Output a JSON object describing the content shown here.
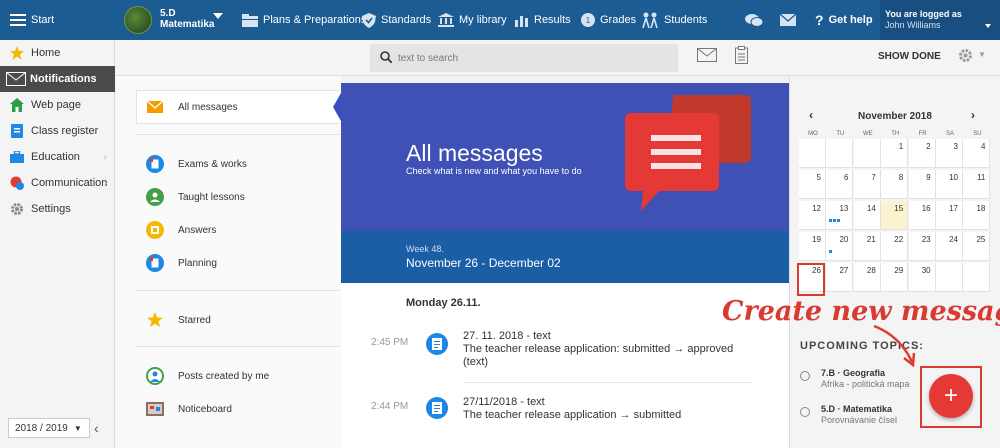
{
  "topbar": {
    "start_label": "Start",
    "class_name": "5.D",
    "subject_name": "Matematika",
    "nav": [
      "Plans & Preparations",
      "Standards",
      "My library",
      "Results",
      "Grades",
      "Students"
    ],
    "help_label": "Get help",
    "logged_label": "You are logged as",
    "user_name": "John Williams"
  },
  "sidebar": {
    "items": [
      "Home",
      "Notifications",
      "Web page",
      "Class register",
      "Education",
      "Communication",
      "Settings"
    ],
    "year": "2018 / 2019"
  },
  "search": {
    "placeholder": "text to search"
  },
  "toolbar": {
    "show_done": "SHOW DONE"
  },
  "filters": {
    "items": [
      "All messages",
      "Exams & works",
      "Taught lessons",
      "Answers",
      "Planning",
      "Starred",
      "Posts created by me",
      "Noticeboard"
    ]
  },
  "banner": {
    "title": "All messages",
    "subtitle": "Check what is new and what you have to do",
    "week_label": "Week 48.",
    "week_dates": "November 26 - December 02"
  },
  "messages": {
    "day": "Monday 26.11.",
    "items": [
      {
        "time": "2:45 PM",
        "title": "27. 11. 2018 - text",
        "body": "The teacher release application: submitted → approved (text)"
      },
      {
        "time": "2:44 PM",
        "title": "27/11/2018 - text",
        "body": "The teacher release application → submitted"
      }
    ]
  },
  "calendar": {
    "month": "November 2018",
    "prev": "‹",
    "next": "›",
    "dow": [
      "MO",
      "TU",
      "WE",
      "TH",
      "FR",
      "SA",
      "SU"
    ],
    "weeks": [
      [
        "",
        "",
        "",
        "1",
        "2",
        "3",
        "4"
      ],
      [
        "5",
        "6",
        "7",
        "8",
        "9",
        "10",
        "11"
      ],
      [
        "12",
        "13",
        "14",
        "15",
        "16",
        "17",
        "18"
      ],
      [
        "19",
        "20",
        "21",
        "22",
        "23",
        "24",
        "25"
      ],
      [
        "26",
        "27",
        "28",
        "29",
        "30",
        "",
        ""
      ]
    ],
    "today": "15"
  },
  "upcoming": {
    "heading": "UPCOMING TOPICS:",
    "items": [
      {
        "title": "7.B · Geografia",
        "subtitle": "Afrika - politická mapa"
      },
      {
        "title": "5.D · Matematika",
        "subtitle": "Porovnávanie čísel"
      }
    ]
  },
  "annotation": "Create new message",
  "fab_label": "+",
  "colors": {
    "topbar": "#1c5c93",
    "banner": "#3f51b5",
    "week_band": "#1a5fa6",
    "accent_red": "#d93a32"
  }
}
